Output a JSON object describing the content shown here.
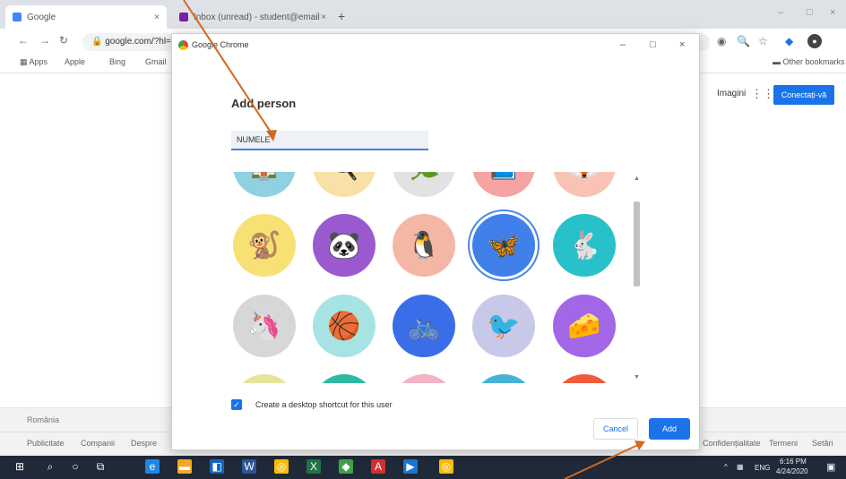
{
  "browser": {
    "tabs": [
      {
        "title": "Google"
      },
      {
        "title": "Inbox (unread) - student@email"
      }
    ],
    "new_tab_glyph": "+",
    "url": "google.com/?hl=ro",
    "window_controls": [
      "–",
      "□",
      "×"
    ],
    "bookmarks": [
      "Apps",
      "Apple",
      "Bing",
      "Gmail"
    ],
    "other_bookmarks": "Other bookmarks",
    "google_header": {
      "images_link": "Imagini",
      "sign_in_button": "Conectați-vă"
    },
    "footer": {
      "country": "România",
      "left_links": [
        "Publicitate",
        "Companii",
        "Despre"
      ],
      "right_links": [
        "Confidențialitate",
        "Termeni",
        "Setări"
      ]
    }
  },
  "dialog": {
    "window_title": "Google Chrome",
    "heading": "Add person",
    "name_value": "NUMELE",
    "avatars": [
      {
        "id": "partial-1",
        "icon": "🏠",
        "color": "#8fd1e0"
      },
      {
        "id": "partial-2",
        "icon": "🍳",
        "color": "#f9e0a6"
      },
      {
        "id": "partial-3",
        "icon": "🌿",
        "color": "#e2e2e2"
      },
      {
        "id": "partial-4",
        "icon": "📘",
        "color": "#f5a3a3"
      },
      {
        "id": "partial-5",
        "icon": "🦊",
        "color": "#f8c3b4"
      },
      {
        "id": "monkey",
        "icon": "🐒",
        "color": "#f7e175"
      },
      {
        "id": "panda",
        "icon": "🐼",
        "color": "#9b59d0"
      },
      {
        "id": "penguin",
        "icon": "🐧",
        "color": "#f4b7a6"
      },
      {
        "id": "butterfly",
        "icon": "🦋",
        "color": "#3f80ea"
      },
      {
        "id": "rabbit",
        "icon": "🐇",
        "color": "#29c1c9"
      },
      {
        "id": "unicorn",
        "icon": "🦄",
        "color": "#d7d7d7"
      },
      {
        "id": "basketball",
        "icon": "🏀",
        "color": "#a8e3e3"
      },
      {
        "id": "bicycle",
        "icon": "🚲",
        "color": "#3a6ee8"
      },
      {
        "id": "bird",
        "icon": "🐦",
        "color": "#c8c8e8"
      },
      {
        "id": "cheese",
        "icon": "🧀",
        "color": "#a167e6"
      },
      {
        "id": "partial-6",
        "icon": "",
        "color": "#e6e49a"
      },
      {
        "id": "partial-7",
        "icon": "",
        "color": "#2fb9a2"
      },
      {
        "id": "partial-8",
        "icon": "",
        "color": "#f2b4c4"
      },
      {
        "id": "partial-9",
        "icon": "",
        "color": "#47b3d4"
      },
      {
        "id": "partial-10",
        "icon": "",
        "color": "#f05b3a"
      }
    ],
    "selected_avatar": "butterfly",
    "desktop_shortcut_label": "Create a desktop shortcut for this user",
    "desktop_shortcut_checked": true,
    "cancel_label": "Cancel",
    "add_label": "Add"
  },
  "taskbar": {
    "system_tray_language": "ENG",
    "clock_time": "6:16 PM",
    "clock_date": "4/24/2020"
  },
  "colors": {
    "accent": "#1a73e8",
    "annotation_arrow": "#d2691e"
  }
}
